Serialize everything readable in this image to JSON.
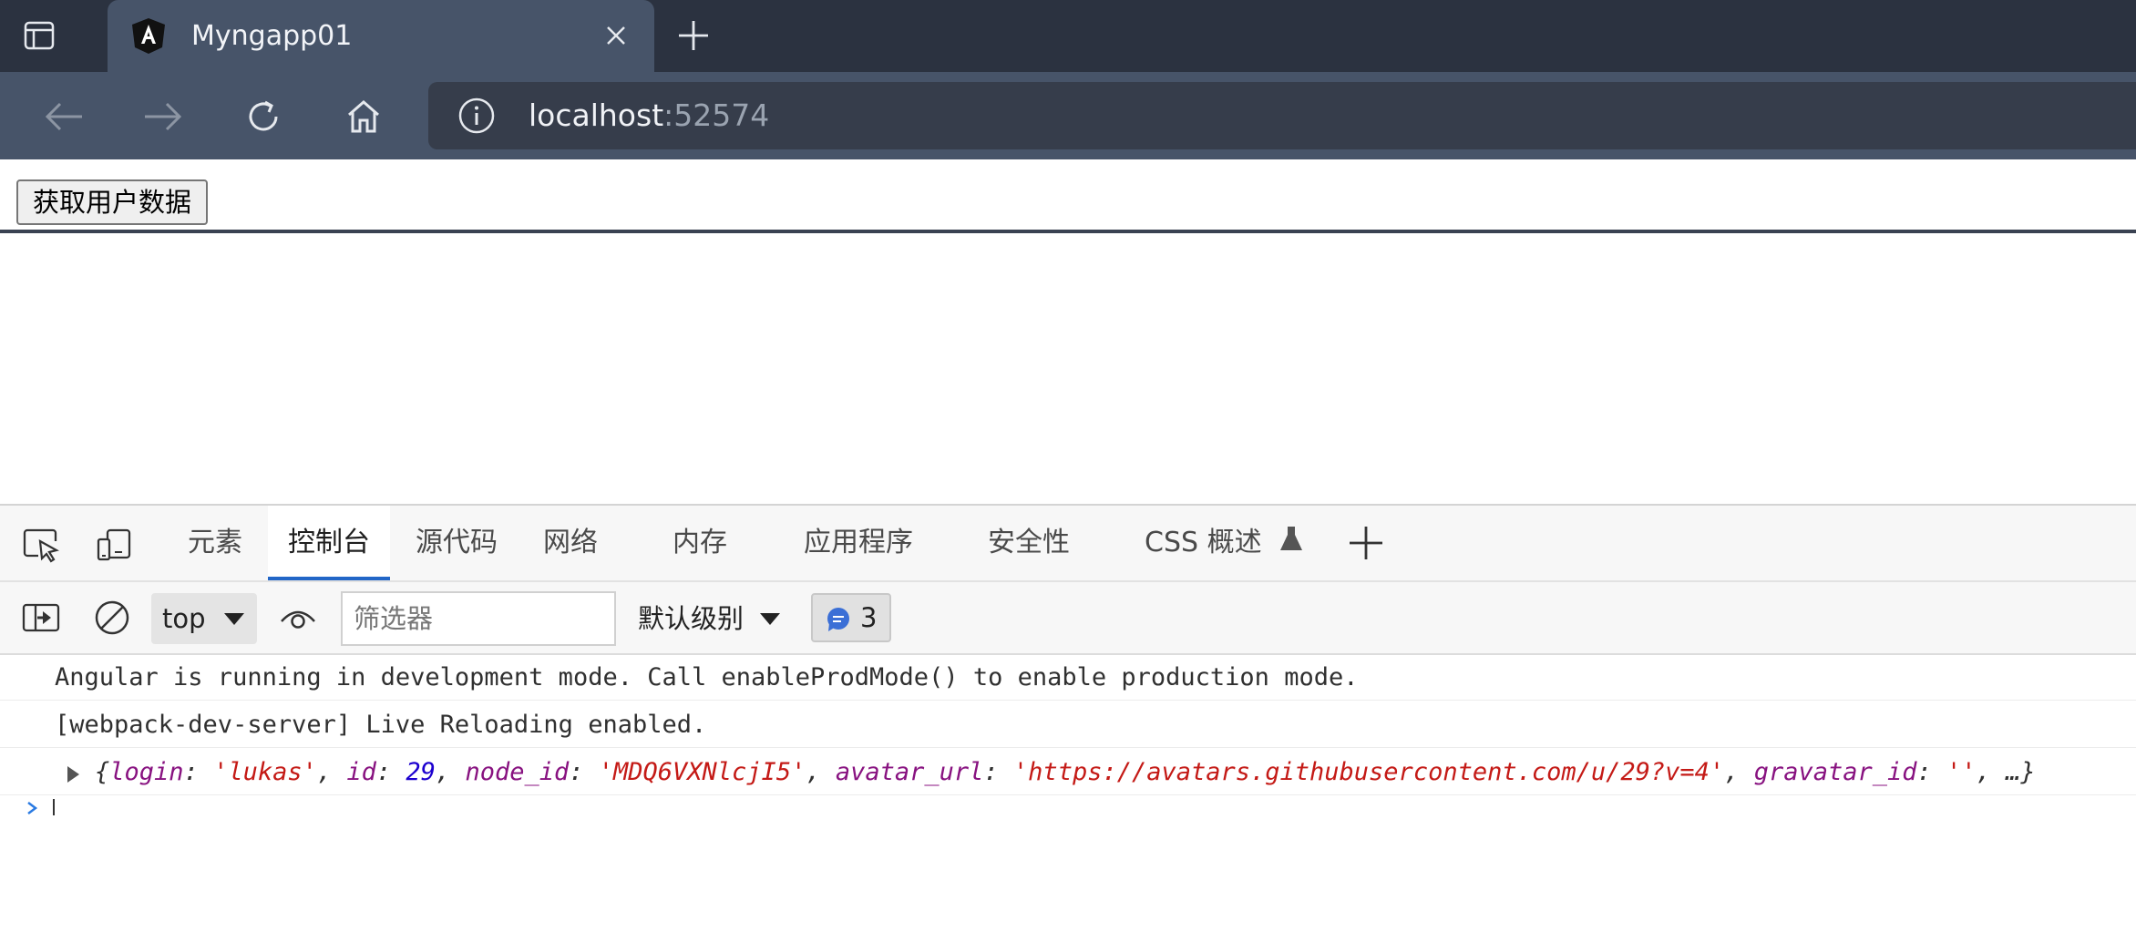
{
  "browser": {
    "tab_title": "Myngapp01",
    "address": {
      "host": "localhost",
      "port": ":52574"
    }
  },
  "page": {
    "button_label": "获取用户数据"
  },
  "devtools": {
    "tabs": [
      "元素",
      "控制台",
      "源代码",
      "网络",
      "内存",
      "应用程序",
      "安全性",
      "CSS 概述"
    ],
    "active_tab": "控制台",
    "console_toolbar": {
      "context": "top",
      "filter_placeholder": "筛选器",
      "level": "默认级别",
      "issues_count": "3"
    },
    "console_messages": [
      "Angular is running in development mode. Call enableProdMode() to enable production mode.",
      "[webpack-dev-server] Live Reloading enabled."
    ],
    "object_preview": {
      "open": "{",
      "login_key": "login",
      "login_val": "'lukas'",
      "id_key": "id",
      "id_val": "29",
      "node_id_key": "node_id",
      "node_id_val": "'MDQ6VXNlcjI5'",
      "avatar_key": "avatar_url",
      "avatar_val": "'https://avatars.githubusercontent.com/u/29?v=4'",
      "gravatar_key": "gravatar_id",
      "gravatar_val": "''",
      "ellipsis": "…}"
    }
  },
  "colors": {
    "tabstrip": "#2b3240",
    "toolbar": "#475469",
    "devtools_active_underline": "#2266c7"
  }
}
